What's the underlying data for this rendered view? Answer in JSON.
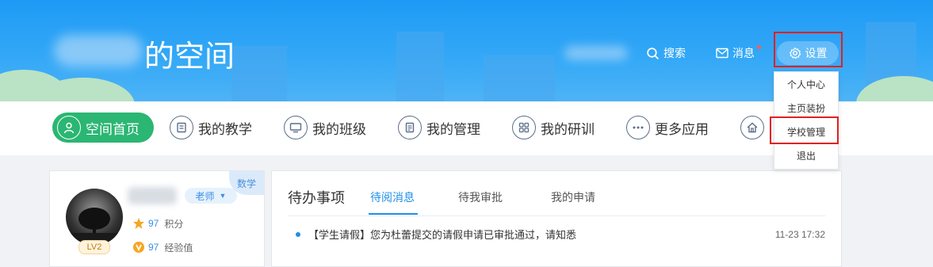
{
  "header": {
    "title": "的空间",
    "search_label": "搜索",
    "messages_label": "消息",
    "settings_label": "设置"
  },
  "settings_menu": {
    "items": [
      "个人中心",
      "主页装扮",
      "学校管理",
      "退出"
    ]
  },
  "nav": {
    "items": [
      {
        "label": "空间首页",
        "icon": "person-icon"
      },
      {
        "label": "我的教学",
        "icon": "tablet-icon"
      },
      {
        "label": "我的班级",
        "icon": "monitor-icon"
      },
      {
        "label": "我的管理",
        "icon": "document-icon"
      },
      {
        "label": "我的研训",
        "icon": "grid-icon"
      },
      {
        "label": "更多应用",
        "icon": "more-icon"
      }
    ]
  },
  "profile": {
    "role": "老师",
    "subject": "数学",
    "level": "LV2",
    "points_value": "97",
    "points_label": "积分",
    "exp_value": "97",
    "exp_label": "经验值"
  },
  "todo": {
    "title": "待办事项",
    "tabs": [
      "待阅消息",
      "待我审批",
      "我的申请"
    ],
    "rows": [
      {
        "text": "【学生请假】您为杜蕾提交的请假申请已审批通过，请知悉",
        "time": "11-23 17:32"
      }
    ]
  },
  "colors": {
    "header_blue": "#1e9af5",
    "accent_green": "#2bb673",
    "link_blue": "#1e8fe8",
    "highlight_red": "#e02020"
  }
}
